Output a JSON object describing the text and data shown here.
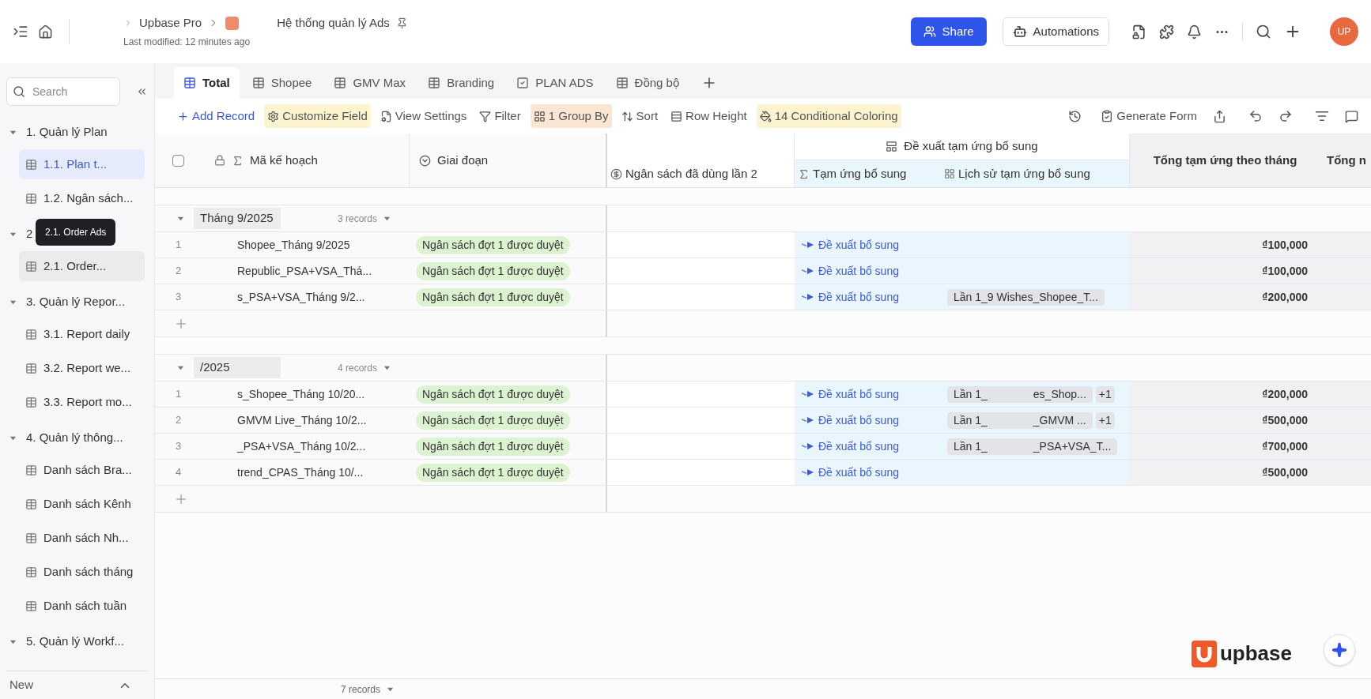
{
  "top_bar": {
    "breadcrumb": [
      "Upbase Pro",
      "Hệ thống quản lý Ads"
    ],
    "last_modified": "Last modified: 12 minutes ago",
    "share": "Share",
    "automations": "Automations",
    "avatar": "UP"
  },
  "sidebar": {
    "search_placeholder": "Search",
    "tooltip": "2.1. Order Ads",
    "groups": [
      {
        "label": "1. Quản lý Plan",
        "expanded": true,
        "children": [
          {
            "label": "1.1. Plan t...",
            "selected": true,
            "hovered": false
          },
          {
            "label": "1.2. Ngân sách...",
            "selected": false,
            "hovered": false
          }
        ]
      },
      {
        "label": "2",
        "expanded": true,
        "children": [
          {
            "label": "2.1. Order...",
            "selected": false,
            "hovered": true
          }
        ]
      },
      {
        "label": "3. Quản lý Repor...",
        "expanded": true,
        "children": [
          {
            "label": "3.1. Report daily",
            "selected": false,
            "hovered": false
          },
          {
            "label": "3.2. Report we...",
            "selected": false,
            "hovered": false
          },
          {
            "label": "3.3. Report mo...",
            "selected": false,
            "hovered": false
          }
        ]
      },
      {
        "label": "4. Quản lý thông...",
        "expanded": true,
        "children": [
          {
            "label": "Danh sách Bra...",
            "selected": false,
            "hovered": false
          },
          {
            "label": "Danh sách Kênh",
            "selected": false,
            "hovered": false
          },
          {
            "label": "Danh sách Nh...",
            "selected": false,
            "hovered": false
          },
          {
            "label": "Danh sách tháng",
            "selected": false,
            "hovered": false
          },
          {
            "label": "Danh sách tuần",
            "selected": false,
            "hovered": false
          }
        ]
      },
      {
        "label": "5. Quản lý Workf...",
        "expanded": true
      }
    ],
    "footer": "New"
  },
  "tabs": [
    {
      "label": "Total",
      "selected": true,
      "kind": "grid"
    },
    {
      "label": "Shopee",
      "selected": false,
      "kind": "grid"
    },
    {
      "label": "GMV Max",
      "selected": false,
      "kind": "grid"
    },
    {
      "label": "Branding",
      "selected": false,
      "kind": "grid"
    },
    {
      "label": "PLAN ADS",
      "selected": false,
      "kind": "form"
    },
    {
      "label": "Đồng bộ",
      "selected": false,
      "kind": "grid"
    }
  ],
  "toolbar": [
    {
      "label": "Add Record",
      "kind": "primary"
    },
    {
      "label": "Customize Field",
      "kind": "yellow"
    },
    {
      "label": "View Settings",
      "kind": "plain"
    },
    {
      "label": "Filter",
      "kind": "plain"
    },
    {
      "label": "1 Group By",
      "kind": "orange"
    },
    {
      "label": "Sort",
      "kind": "plain"
    },
    {
      "label": "Row Height",
      "kind": "plain"
    },
    {
      "label": "14 Conditional Coloring",
      "kind": "yellow"
    }
  ],
  "generate_form": "Generate Form",
  "table": {
    "select_all_checked": false,
    "columns": [
      "Mã kế hoạch",
      "Giai đoạn",
      "Ngân sách đã dùng lần 2",
      "Tạm ứng bổ sung",
      "Lịch sử tạm ứng bổ sung",
      "Tổng tạm ứng theo tháng",
      "Tổng n"
    ],
    "column_group": "Đề xuất tạm ứng bổ sung",
    "groups": [
      {
        "label": "Tháng 9/2025",
        "count": "3 records",
        "rows": [
          {
            "index": "1",
            "code": "Shopee_Tháng 9/2025",
            "stage": "Ngân sách đợt 1 được duyệt",
            "proposal": "Đề xuất bổ sung",
            "total": "₫100,000"
          },
          {
            "index": "2",
            "code": "Republic_PSA+VSA_Thá...",
            "stage": "Ngân sách đợt 1 được duyệt",
            "proposal": "Đề xuất bổ sung",
            "total": "₫100,000"
          },
          {
            "index": "3",
            "code": "s_PSA+VSA_Tháng 9/2...",
            "stage": "Ngân sách đợt 1 được duyệt",
            "proposal": "Đề xuất bổ sung",
            "history": "Lần 1_9 Wishes_Shopee_T...",
            "total": "₫200,000"
          }
        ]
      },
      {
        "label": "/2025",
        "count": "4 records",
        "rows": [
          {
            "index": "1",
            "code": "s_Shopee_Tháng 10/20...",
            "stage": "Ngân sách đợt 1 được duyệt",
            "proposal": "Đề xuất bổ sung",
            "history": "Lần 1_",
            "history_tail": "es_Shop...",
            "more": "+1",
            "total": "₫200,000"
          },
          {
            "index": "2",
            "code": "GMVM Live_Tháng 10/2...",
            "stage": "Ngân sách đợt 1 được duyệt",
            "proposal": "Đề xuất bổ sung",
            "history": "Lần 1_",
            "history_tail": "_GMVM ...",
            "more": "+1",
            "total": "₫500,000"
          },
          {
            "index": "3",
            "code": "_PSA+VSA_Tháng 10/2...",
            "stage": "Ngân sách đợt 1 được duyệt",
            "proposal": "Đề xuất bổ sung",
            "history": "Lần 1_",
            "history_tail": "_PSA+VSA_T...",
            "total": "₫700,000"
          },
          {
            "index": "4",
            "code": "trend_CPAS_Tháng 10/...",
            "stage": "Ngân sách đợt 1 được duyệt",
            "proposal": "Đề xuất bổ sung",
            "total": "₫500,000"
          }
        ]
      }
    ],
    "footer": "7 records"
  },
  "brand": "upbase"
}
